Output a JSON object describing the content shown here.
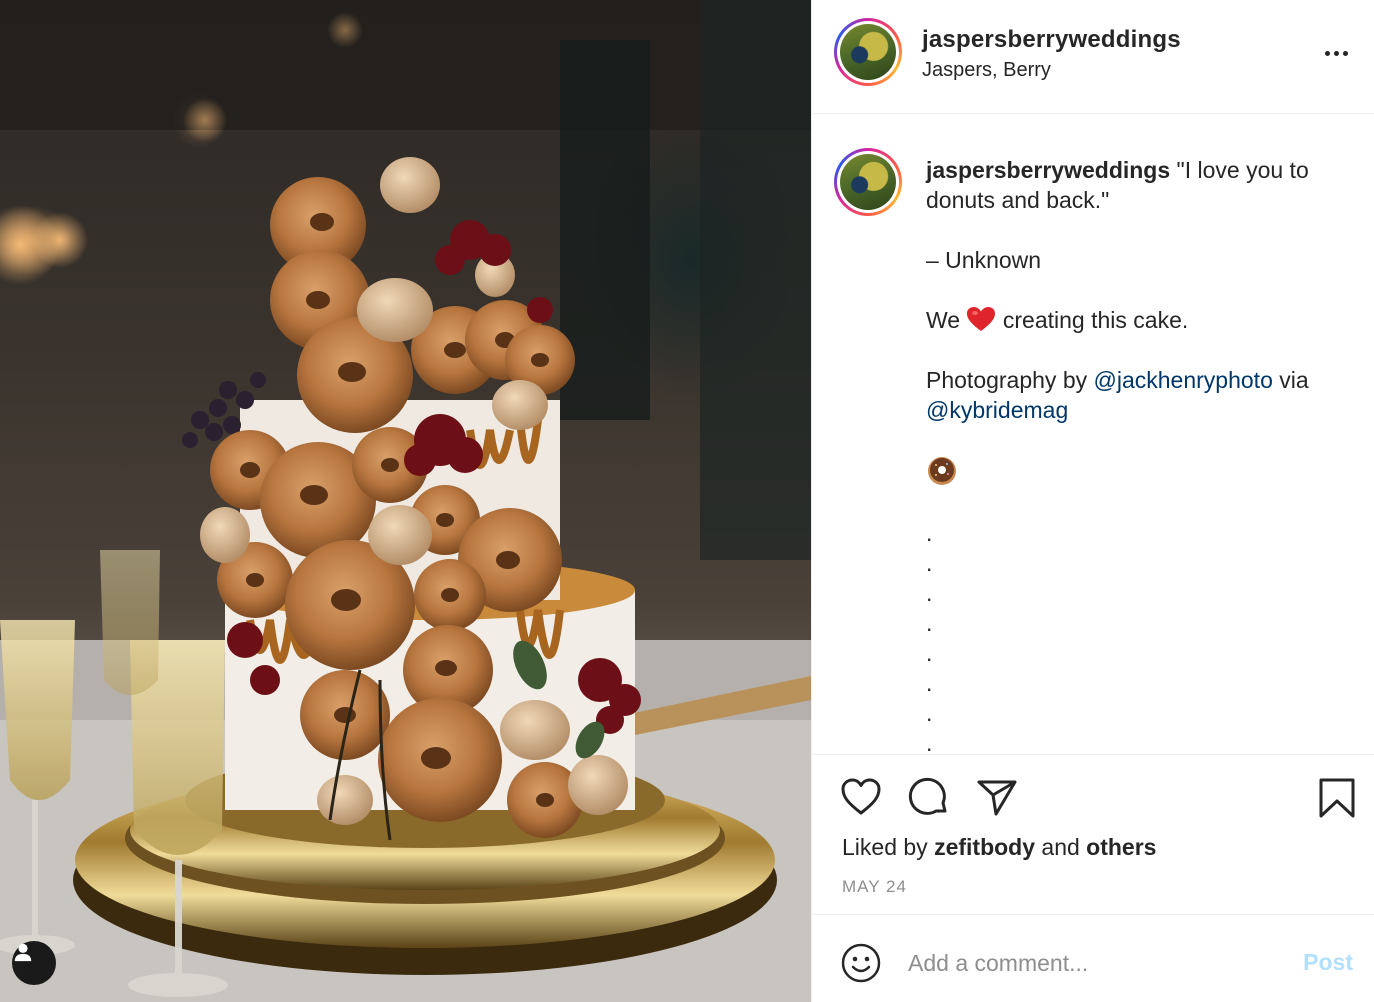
{
  "post": {
    "username": "jaspersberryweddings",
    "location": "Jaspers, Berry",
    "photo_subject": "donut-cake-photo"
  },
  "caption": {
    "username": "jaspersberryweddings",
    "line1": " \"I love you to donuts and back.\"",
    "line2": "– Unknown",
    "line3_before": "We ",
    "line3_after": " creating this cake.",
    "line4_before": "Photography by ",
    "mention1": "@jackhenryphoto",
    "line4_mid": " via",
    "mention2": "@kybridemag",
    "dots": [
      ".",
      ".",
      ".",
      ".",
      ".",
      ".",
      ".",
      "."
    ]
  },
  "actions": {
    "like_icon": "heart-icon",
    "comment_icon": "comment-icon",
    "share_icon": "share-icon",
    "save_icon": "bookmark-icon"
  },
  "likes": {
    "prefix": "Liked by ",
    "user": "zefitbody",
    "middle": " and ",
    "suffix": "others"
  },
  "date": "MAY 24",
  "comment": {
    "placeholder": "Add a comment...",
    "post_label": "Post",
    "emoji_icon": "smiley-icon"
  },
  "colors": {
    "link": "#00376b",
    "post_disabled": "#b2dffc",
    "muted": "#8e8e8e",
    "heart": "#e0242c"
  }
}
